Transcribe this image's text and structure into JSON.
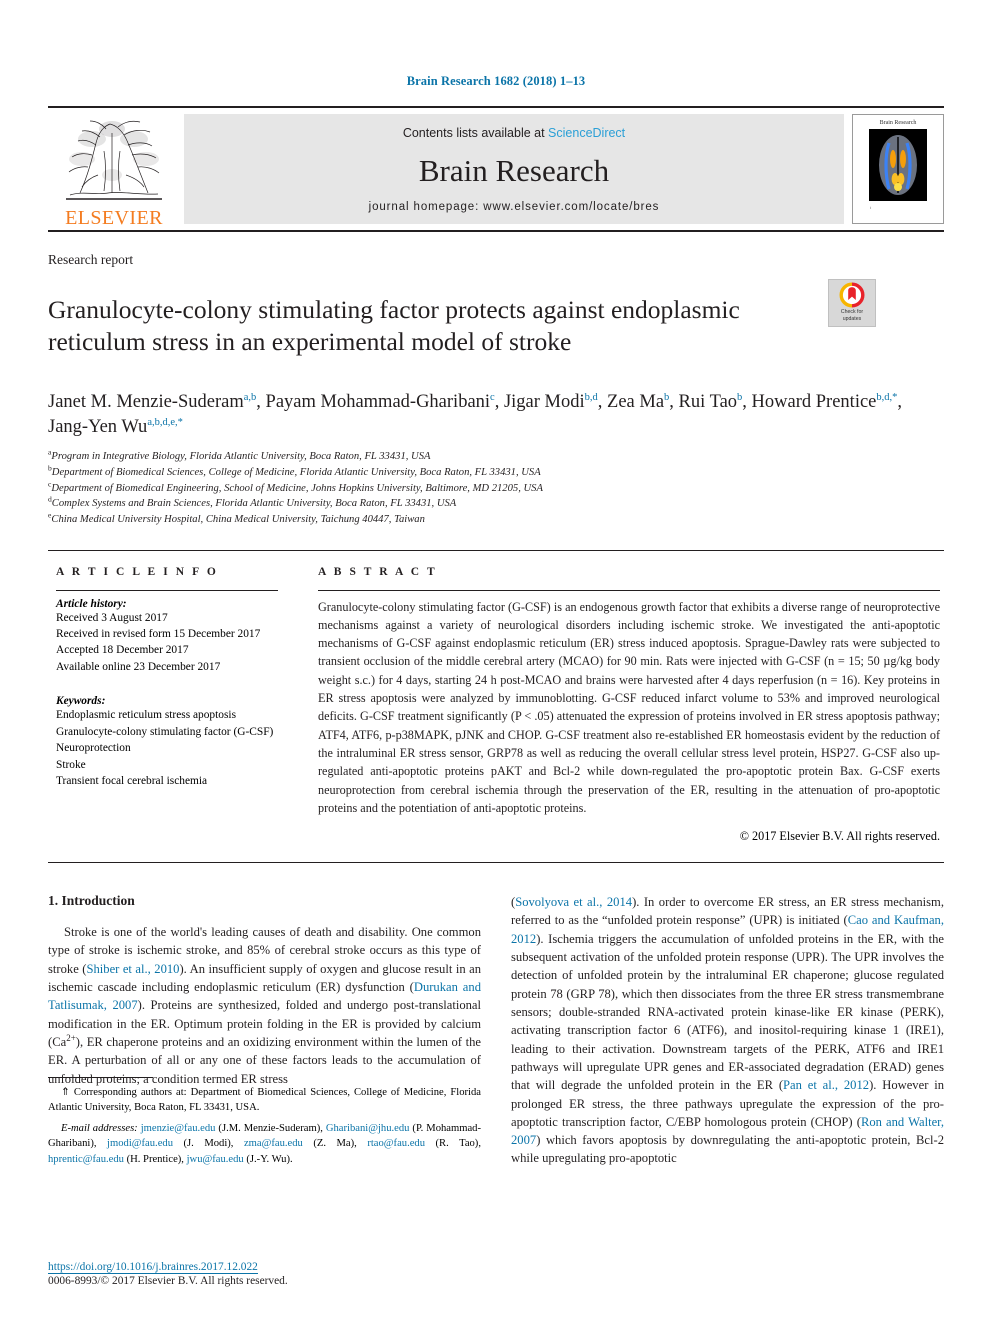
{
  "running_head": "Brain Research 1682 (2018) 1–13",
  "banner": {
    "publisher_name": "ELSEVIER",
    "contents_prefix": "Contents lists available at ",
    "contents_link": "ScienceDirect",
    "journal_name": "Brain Research",
    "homepage": "journal homepage: www.elsevier.com/locate/bres",
    "cover_title": "Brain Research",
    "cover_footer": "t"
  },
  "article": {
    "type": "Research report",
    "title": "Granulocyte-colony stimulating factor protects against endoplasmic reticulum stress in an experimental model of stroke",
    "crossmark_line1": "Check for",
    "crossmark_line2": "updates"
  },
  "authors": [
    {
      "name": "Janet M. Menzie-Suderam",
      "sup": "a,b",
      "sep": ", "
    },
    {
      "name": "Payam Mohammad-Gharibani",
      "sup": "c",
      "sep": ", "
    },
    {
      "name": "Jigar Modi",
      "sup": "b,d",
      "sep": ", "
    },
    {
      "name": "Zea Ma",
      "sup": "b",
      "sep": ", "
    },
    {
      "name": "Rui Tao",
      "sup": "b",
      "sep": ", "
    },
    {
      "name": "Howard Prentice",
      "sup": "b,d,*",
      "sep": ", "
    },
    {
      "name": "Jang-Yen Wu",
      "sup": "a,b,d,e,*",
      "sep": ""
    }
  ],
  "affiliations": [
    {
      "mark": "a",
      "text": "Program in Integrative Biology, Florida Atlantic University, Boca Raton, FL 33431, USA"
    },
    {
      "mark": "b",
      "text": "Department of Biomedical Sciences, College of Medicine, Florida Atlantic University, Boca Raton, FL 33431, USA"
    },
    {
      "mark": "c",
      "text": "Department of Biomedical Engineering, School of Medicine, Johns Hopkins University, Baltimore, MD 21205, USA"
    },
    {
      "mark": "d",
      "text": "Complex Systems and Brain Sciences, Florida Atlantic University, Boca Raton, FL 33431, USA"
    },
    {
      "mark": "e",
      "text": "China Medical University Hospital, China Medical University, Taichung 40447, Taiwan"
    }
  ],
  "article_info": {
    "heading": "A R T I C L E  I N F O",
    "history_label": "Article history:",
    "history": [
      "Received 3 August 2017",
      "Received in revised form 15 December 2017",
      "Accepted 18 December 2017",
      "Available online 23 December 2017"
    ],
    "keywords_label": "Keywords:",
    "keywords": [
      "Endoplasmic reticulum stress apoptosis",
      "Granulocyte-colony stimulating factor (G-CSF)",
      "Neuroprotection",
      "Stroke",
      "Transient focal cerebral ischemia"
    ]
  },
  "abstract": {
    "heading": "A B S T R A C T",
    "text": "Granulocyte-colony stimulating factor (G-CSF) is an endogenous growth factor that exhibits a diverse range of neuroprotective mechanisms against a variety of neurological disorders including ischemic stroke. We investigated the anti-apoptotic mechanisms of G-CSF against endoplasmic reticulum (ER) stress induced apoptosis. Sprague-Dawley rats were subjected to transient occlusion of the middle cerebral artery (MCAO) for 90 min. Rats were injected with G-CSF (n = 15; 50 µg/kg body weight s.c.) for 4 days, starting 24 h post-MCAO and brains were harvested after 4 days reperfusion (n = 16). Key proteins in ER stress apoptosis were analyzed by immunoblotting. G-CSF reduced infarct volume to 53% and improved neurological deficits. G-CSF treatment significantly (P < .05) attenuated the expression of proteins involved in ER stress apoptosis pathway; ATF4, ATF6, p-p38MAPK, pJNK and CHOP. G-CSF treatment also re-established ER homeostasis evident by the reduction of the intraluminal ER stress sensor, GRP78 as well as reducing the overall cellular stress level protein, HSP27. G-CSF also up-regulated anti-apoptotic proteins pAKT and Bcl-2 while down-regulated the pro-apoptotic protein Bax. G-CSF exerts neuroprotection from cerebral ischemia through the preservation of the ER, resulting in the attenuation of pro-apoptotic proteins and the potentiation of anti-apoptotic proteins.",
    "copyright": "© 2017 Elsevier B.V. All rights reserved."
  },
  "introduction": {
    "heading": "1. Introduction",
    "left_part1": "Stroke is one of the world's leading causes of death and disability. One common type of stroke is ischemic stroke, and 85% of cerebral stroke occurs as this type of stroke (",
    "cite1": "Shiber et al., 2010",
    "left_part2": "). An insufficient supply of oxygen and glucose result in an ischemic cascade including endoplasmic reticulum (ER) dysfunction (",
    "cite2": "Durukan and Tatlisumak, 2007",
    "left_part3": "). Proteins are synthesized, folded and undergo post-translational modification in the ER. Optimum protein folding in the ER is provided by calcium (Ca",
    "ca_sup": "2+",
    "left_part4": "), ER chaperone proteins and an oxidizing environment within the lumen of the ER. A perturbation of all or any one of these factors leads to the accumulation of unfolded proteins; a condition termed ER stress",
    "right_cite1": "Sovolyova et al., 2014",
    "right_part1": "). In order to overcome ER stress, an ER stress mechanism, referred to as the “unfolded protein response” (UPR) is initiated (",
    "right_cite2": "Cao and Kaufman, 2012",
    "right_part2": "). Ischemia triggers the accumulation of unfolded proteins in the ER, with the subsequent activation of the unfolded protein response (UPR). The UPR involves the detection of unfolded protein by the intraluminal ER chaperone; glucose regulated protein 78 (GRP 78), which then dissociates from the three ER stress transmembrane sensors; double-stranded RNA-activated protein kinase-like ER kinase (PERK), activating transcription factor 6 (ATF6), and inositol-requiring kinase 1 (IRE1), leading to their activation. Downstream targets of the PERK, ATF6 and IRE1 pathways will upregulate UPR genes and ER-associated degradation (ERAD) genes that will degrade the unfolded protein in the ER (",
    "right_cite3": "Pan et al., 2012",
    "right_part3": "). However in prolonged ER stress, the three pathways upregulate the expression of the pro-apoptotic transcription factor, C/EBP homologous protein (CHOP) (",
    "right_cite4": "Ron and Walter, 2007",
    "right_part4": ") which favors apoptosis by downregulating the anti-apoptotic protein, Bcl-2 while upregulating pro-apoptotic"
  },
  "footnote": {
    "corresponding": "⇑ Corresponding authors at: Department of Biomedical Sciences, College of Medicine, Florida Atlantic University, Boca Raton, FL 33431, USA.",
    "email_label": "E-mail addresses:",
    "emails": [
      {
        "addr": "jmenzie@fau.edu",
        "who": " (J.M. Menzie-Suderam), "
      },
      {
        "addr": "Gharibani@jhu.edu",
        "who": " (P. Mohammad-Gharibani), "
      },
      {
        "addr": "jmodi@fau.edu",
        "who": " (J. Modi), "
      },
      {
        "addr": "zma@fau.edu",
        "who": " (Z. Ma), "
      },
      {
        "addr": "rtao@fau.edu",
        "who": " (R. Tao), "
      },
      {
        "addr": "hprentic@fau.edu",
        "who": " (H. Prentice), "
      },
      {
        "addr": "jwu@fau.edu",
        "who": " (J.-Y. Wu)."
      }
    ]
  },
  "page_footer": {
    "doi": "https://doi.org/10.1016/j.brainres.2017.12.022",
    "issn": "0006-8993/© 2017 Elsevier B.V. All rights reserved."
  },
  "colors": {
    "link": "#0b74a8",
    "sciencedirect": "#2a9fd6",
    "elsevier_orange": "#f47c20",
    "banner_grey": "#e6e6e6"
  }
}
